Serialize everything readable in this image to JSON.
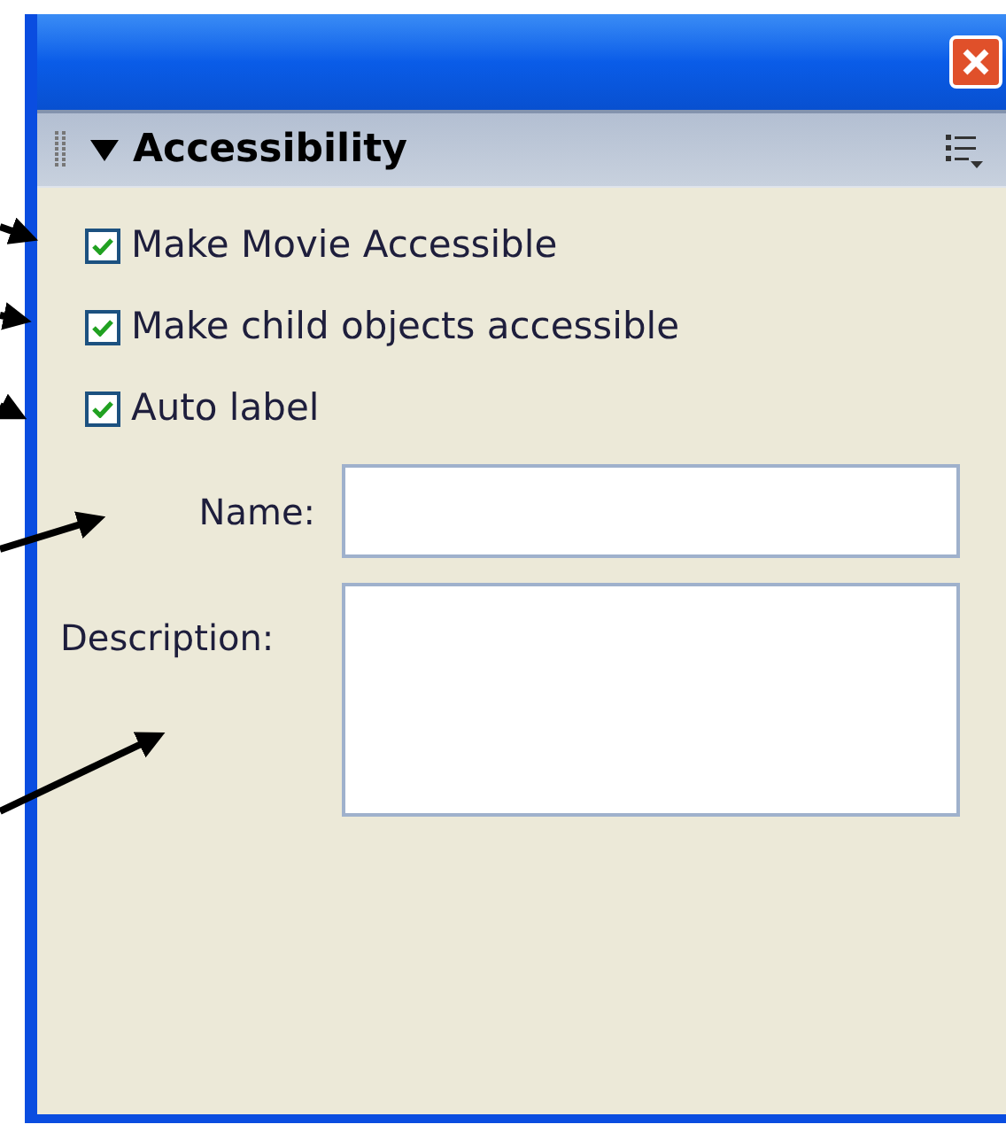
{
  "panel": {
    "title": "Accessibility",
    "expanded": true
  },
  "checkboxes": [
    {
      "label": "Make Movie Accessible",
      "checked": true
    },
    {
      "label": "Make child objects accessible",
      "checked": true
    },
    {
      "label": "Auto label",
      "checked": true
    }
  ],
  "fields": [
    {
      "kind": "line",
      "label": "Name:"
    },
    {
      "kind": "area",
      "label": "Description:"
    }
  ]
}
